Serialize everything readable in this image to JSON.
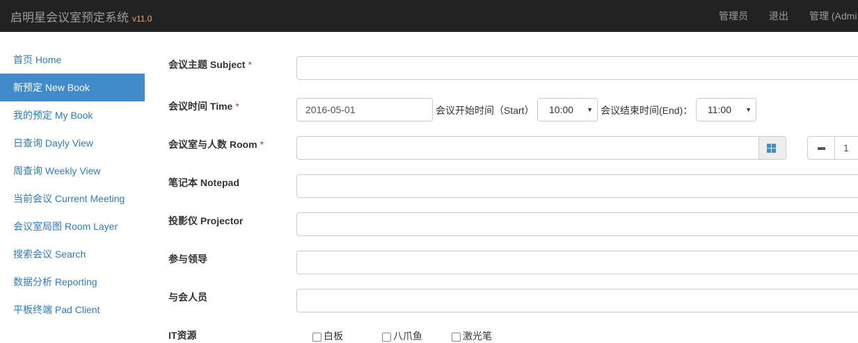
{
  "navbar": {
    "brand": "启明星会议室预定系统",
    "version": "v11.0",
    "links": [
      "管理员",
      "退出",
      "管理 (Admi"
    ]
  },
  "sidebar": {
    "items": [
      {
        "label": "首页 Home",
        "active": false
      },
      {
        "label": "新预定 New Book",
        "active": true
      },
      {
        "label": "我的预定 My Book",
        "active": false
      },
      {
        "label": "日查询 Dayly View",
        "active": false
      },
      {
        "label": "周查询 Weekly View",
        "active": false
      },
      {
        "label": "当前会议 Current Meeting",
        "active": false
      },
      {
        "label": "会议室局图 Room Layer",
        "active": false
      },
      {
        "label": "搜索会议 Search",
        "active": false
      },
      {
        "label": "数据分析 Reporting",
        "active": false
      },
      {
        "label": "平板终端 Pad Client",
        "active": false
      }
    ]
  },
  "form": {
    "required_mark": "*",
    "subject": {
      "label": "会议主题 Subject",
      "value": ""
    },
    "time": {
      "label": "会议时间 Time",
      "date": "2016-05-01",
      "start_label": "会议开始时间（Start）",
      "start_value": "10:00",
      "end_label": "会议结束时间(End)：",
      "end_value": "11:00"
    },
    "room": {
      "label": "会议室与人数 Room",
      "value": "",
      "people": "1"
    },
    "notepad": {
      "label": "笔记本 Notepad",
      "value": ""
    },
    "projector": {
      "label": "投影仪 Projector",
      "value": ""
    },
    "leaders": {
      "label": "参与领导",
      "value": ""
    },
    "attendees": {
      "label": "与会人员",
      "value": ""
    },
    "it": {
      "label": "IT资源",
      "options": [
        "白板",
        "八爪鱼",
        "激光笔"
      ]
    }
  },
  "colors": {
    "navbar": "#222222",
    "active": "#428bca",
    "link": "#337ab7",
    "version": "#f0ad4e",
    "required": "#a94442"
  }
}
